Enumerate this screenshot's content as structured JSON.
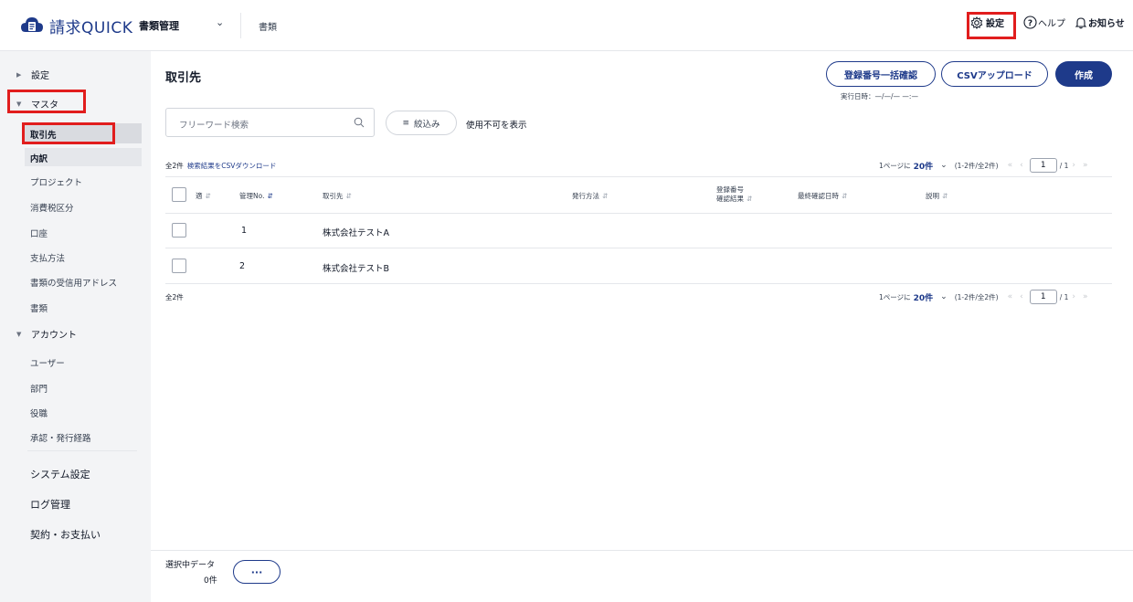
{
  "header": {
    "app_name": "請求QUICK",
    "app_menu": "書類管理",
    "breadcrumb": "書類",
    "settings_label": "設定",
    "help_label": "ヘルプ",
    "notice_label": "お知らせ"
  },
  "sidebar": {
    "settings_group": "設定",
    "master_group": "マスタ",
    "master_items": [
      "取引先",
      "内訳",
      "プロジェクト",
      "消費税区分",
      "口座",
      "支払方法",
      "書類の受信用アドレス",
      "書類"
    ],
    "account_group": "アカウント",
    "account_items": [
      "ユーザー",
      "部門",
      "役職",
      "承認・発行経路"
    ],
    "system_settings": "システム設定",
    "log_management": "ログ管理",
    "contract_payment": "契約・お支払い"
  },
  "main": {
    "title": "取引先",
    "confirm_button": "登録番号一括確認",
    "csv_upload_button": "CSVアップロード",
    "create_button": "作成",
    "exec_date": "実行日時：—/—/— —:—",
    "search_placeholder": "フリーワード検索",
    "filter_button": "絞込み",
    "show_disabled": "使用不可を表示",
    "total_count": "全2件",
    "csv_download_link": "検索結果をCSVダウンロード",
    "pagination": {
      "per_page_prefix": "1ページに",
      "per_page_value": "20件",
      "range": "(1-2件/全2件)",
      "current_page": "1",
      "total_pages": "/ 1"
    },
    "table": {
      "columns": {
        "fit": "適",
        "code": "管理No.",
        "partner": "取引先",
        "issue_method": "発行方法",
        "reg_number_line1": "登録番号",
        "reg_number_line2": "確認結果",
        "last_checked": "最終確認日時",
        "description": "説明"
      },
      "rows": [
        {
          "code": "1",
          "partner": "株式会社テストA"
        },
        {
          "code": "2",
          "partner": "株式会社テストB"
        }
      ]
    },
    "bottom_total": "全2件"
  },
  "footer": {
    "selected_label": "選択中データ",
    "selected_count": "0件",
    "more_button": "···"
  },
  "colors": {
    "brand": "#1e3a8a",
    "highlight": "#e11d1d",
    "sidebar_bg": "#f3f4f6"
  }
}
